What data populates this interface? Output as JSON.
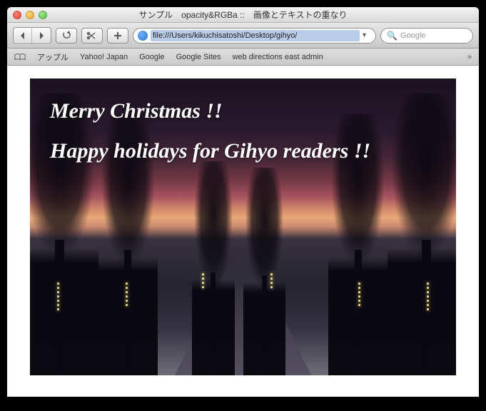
{
  "window": {
    "title": "サンプル　opacity&RGBa ::　画像とテキストの重なり"
  },
  "toolbar": {
    "url": "file:///Users/kikuchisatoshi/Desktop/gihyo/",
    "search_placeholder": "Google"
  },
  "bookmarks": {
    "items": [
      {
        "label": "アップル"
      },
      {
        "label": "Yahoo! Japan"
      },
      {
        "label": "Google"
      },
      {
        "label": "Google Sites"
      },
      {
        "label": "web directions east admin"
      }
    ]
  },
  "content": {
    "greeting_line1": "Merry Christmas !!",
    "greeting_line2": "Happy holidays for Gihyo readers !!"
  }
}
